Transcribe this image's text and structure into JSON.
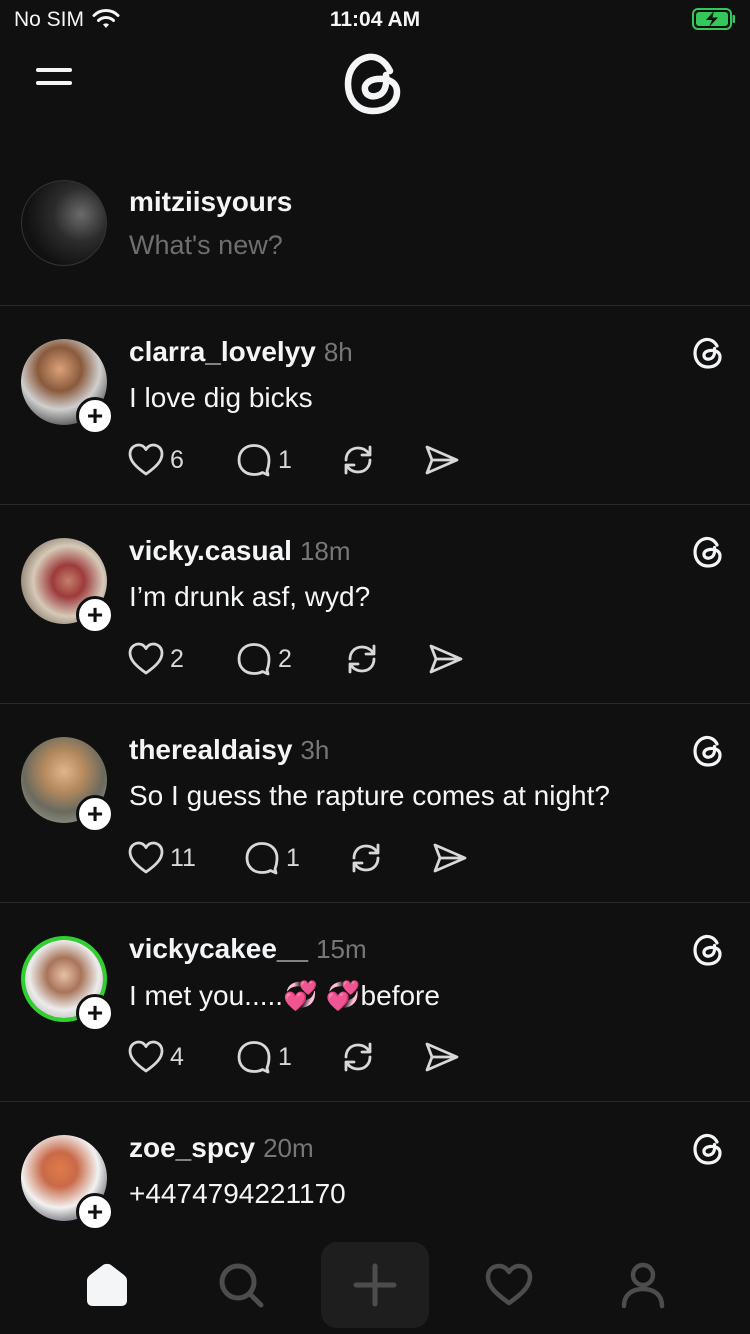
{
  "status_bar": {
    "carrier": "No SIM",
    "time": "11:04 AM",
    "battery_color": "#34c759"
  },
  "composer": {
    "username": "mitziisyours",
    "placeholder": "What's new?"
  },
  "posts": [
    {
      "username": "clarra_lovelyy",
      "time": "8h",
      "text": "I love dig bicks",
      "likes": "6",
      "replies": "1",
      "avatar_ring": false
    },
    {
      "username": "vicky.casual",
      "time": "18m",
      "text": "I’m drunk asf, wyd?",
      "likes": "2",
      "replies": "2",
      "avatar_ring": false
    },
    {
      "username": "therealdaisy",
      "time": "3h",
      "text": "So I guess the rapture comes at night?",
      "likes": "11",
      "replies": "1",
      "avatar_ring": false
    },
    {
      "username": "vickycakee__",
      "time": "15m",
      "text": "I met you.....💞 💞before",
      "likes": "4",
      "replies": "1",
      "avatar_ring": true
    },
    {
      "username": "zoe_spcy",
      "time": "20m",
      "text": "+4474794221170",
      "likes": "",
      "replies": "",
      "avatar_ring": false
    }
  ],
  "tab_bar": {
    "tabs": [
      "home-icon",
      "search-icon",
      "create-icon",
      "activity-heart-icon",
      "profile-icon"
    ],
    "active": "home-icon"
  },
  "colors": {
    "background": "#101010",
    "text": "#f3f5f7",
    "muted": "#777777",
    "story_ring": "#2ed12e"
  }
}
